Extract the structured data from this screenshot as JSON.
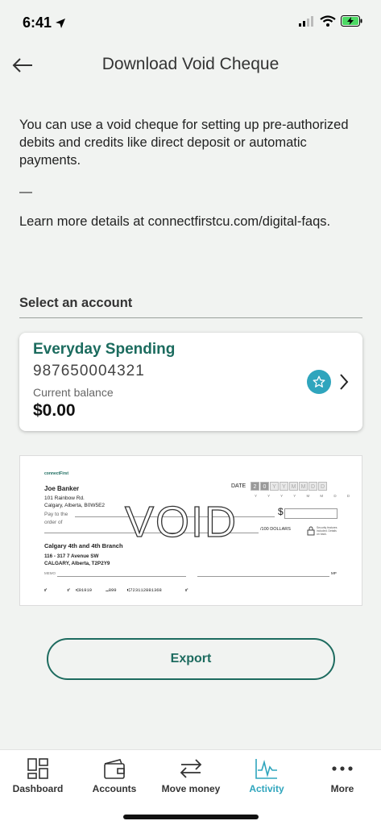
{
  "status": {
    "time": "6:41"
  },
  "header": {
    "title": "Download Void Cheque"
  },
  "intro": {
    "text": "You can use a void cheque for setting up pre-authorized debits and credits like direct deposit or automatic payments.",
    "dash": "—",
    "learn_more": "Learn more details at connectfirstcu.com/digital-faqs."
  },
  "select_account": {
    "label": "Select an account",
    "account": {
      "name": "Everyday Spending",
      "number": "987650004321",
      "balance_label": "Current balance",
      "balance": "$0.00",
      "icon": "star-icon"
    }
  },
  "cheque": {
    "logo": "connectFirst",
    "owner_name": "Joe Banker",
    "owner_address1": "101 Rainbow Rd.",
    "owner_address2": "Calgary, Alberta, B0W5E2",
    "date_label": "DATE",
    "date_digits": [
      "2",
      "0",
      "Y",
      "Y",
      "M",
      "M",
      "D",
      "D"
    ],
    "date_hint": "Y Y Y Y M M D D",
    "pay_label1": "Pay to the",
    "pay_label2": "order of",
    "dollar_sign": "$",
    "void_text": "VOID",
    "dollars_label": "/100 DOLLARS",
    "security_note": "Security features included. Details on back.",
    "branch_name": "Calgary 4th and 4th Branch",
    "branch_address1": "116 - 317 7 Avenue SW",
    "branch_address2": "CALGARY, Alberta, T2P2Y9",
    "memo_label": "MEMO",
    "mp_label": "MP",
    "micr_transit": "01919",
    "micr_institution": "899",
    "micr_account": "723112881368"
  },
  "actions": {
    "export_label": "Export"
  },
  "tabs": [
    {
      "label": "Dashboard",
      "icon": "dashboard-icon"
    },
    {
      "label": "Accounts",
      "icon": "wallet-icon"
    },
    {
      "label": "Move money",
      "icon": "transfer-icon"
    },
    {
      "label": "Activity",
      "icon": "activity-icon",
      "active": true
    },
    {
      "label": "More",
      "icon": "more-icon"
    }
  ],
  "colors": {
    "brand_green": "#1d6b5f",
    "accent_teal": "#2fa5bd",
    "background": "#f1f3f1"
  }
}
